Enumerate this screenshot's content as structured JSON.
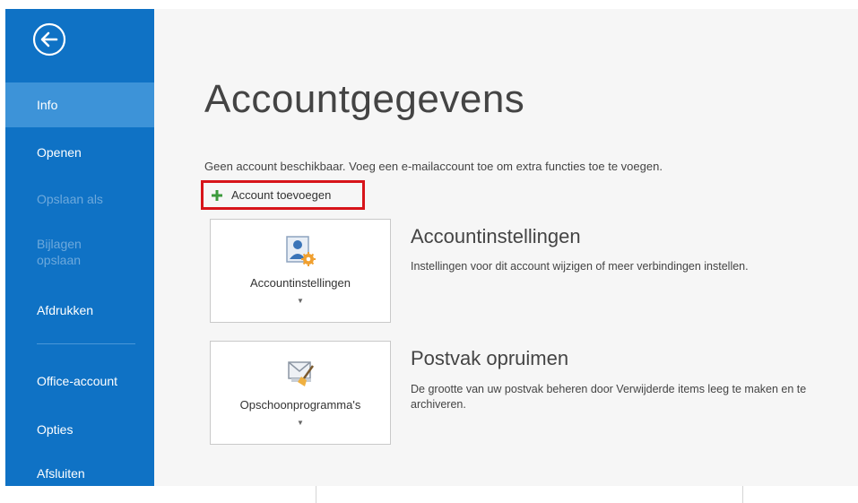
{
  "sidebar": {
    "back_icon": "back-arrow-icon",
    "items": [
      {
        "label": "Info",
        "state": "active"
      },
      {
        "label": "Openen",
        "state": "normal"
      },
      {
        "label": "Opslaan als",
        "state": "disabled"
      },
      {
        "label": "Bijlagen opslaan",
        "state": "disabled"
      },
      {
        "label": "Afdrukken",
        "state": "normal"
      },
      {
        "label": "Office-account",
        "state": "normal"
      },
      {
        "label": "Opties",
        "state": "normal"
      },
      {
        "label": "Afsluiten",
        "state": "normal"
      }
    ],
    "colors": {
      "background": "#0f72c5",
      "active": "#3d93d8",
      "disabled_text": "#6da9dc"
    }
  },
  "main": {
    "title": "Accountgegevens",
    "info_text": "Geen account beschikbaar. Voeg een e-mailaccount toe om extra functies toe te voegen.",
    "add_account": {
      "label": "Account toevoegen",
      "icon": "plus-icon",
      "highlight_color": "#d7141a"
    },
    "sections": [
      {
        "tile_label": "Accountinstellingen",
        "tile_icon": "account-settings-icon",
        "title": "Accountinstellingen",
        "description": "Instellingen voor dit account wijzigen of meer verbindingen instellen."
      },
      {
        "tile_label": "Opschoonprogramma's",
        "tile_icon": "cleanup-tools-icon",
        "title": "Postvak opruimen",
        "description": "De grootte van uw postvak beheren door Verwijderde items leeg te maken en te archiveren."
      }
    ]
  }
}
